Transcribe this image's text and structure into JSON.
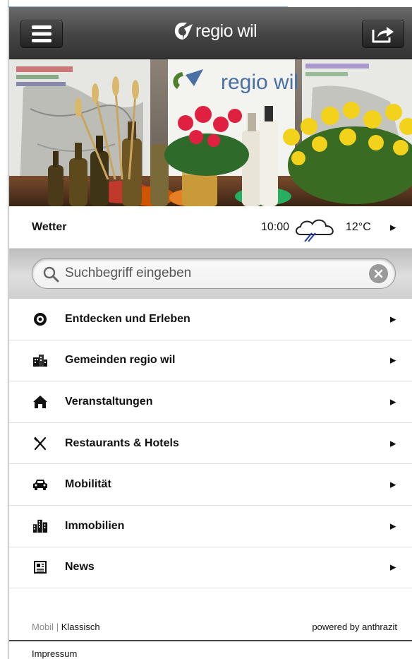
{
  "header": {
    "logo_text": "regio wil",
    "menu_icon": "hamburger-menu-icon",
    "share_icon": "share-icon"
  },
  "hero": {
    "banner_text": "regio wil"
  },
  "weather": {
    "label": "Wetter",
    "time": "10:00",
    "icon": "cloud-rain-icon",
    "temperature": "12°C"
  },
  "search": {
    "placeholder": "Suchbegriff eingeben",
    "value": ""
  },
  "menu": {
    "items": [
      {
        "label": "Entdecken und Erleben",
        "icon": "target-icon"
      },
      {
        "label": "Gemeinden regio wil",
        "icon": "buildings-icon"
      },
      {
        "label": "Veranstaltungen",
        "icon": "tent-icon"
      },
      {
        "label": "Restaurants & Hotels",
        "icon": "cutlery-icon"
      },
      {
        "label": "Mobilität",
        "icon": "car-icon"
      },
      {
        "label": "Immobilien",
        "icon": "city-icon"
      },
      {
        "label": "News",
        "icon": "newspaper-icon"
      }
    ]
  },
  "footer": {
    "mobil": "Mobil",
    "separator": "|",
    "klassisch": "Klassisch",
    "powered": "powered by anthrazit",
    "impressum": "Impressum"
  },
  "colors": {
    "header_dark": "#333333",
    "search_bg": "#d0d0d0",
    "brand_green": "#4f7f2a",
    "brand_blue": "#4a6fa5"
  }
}
